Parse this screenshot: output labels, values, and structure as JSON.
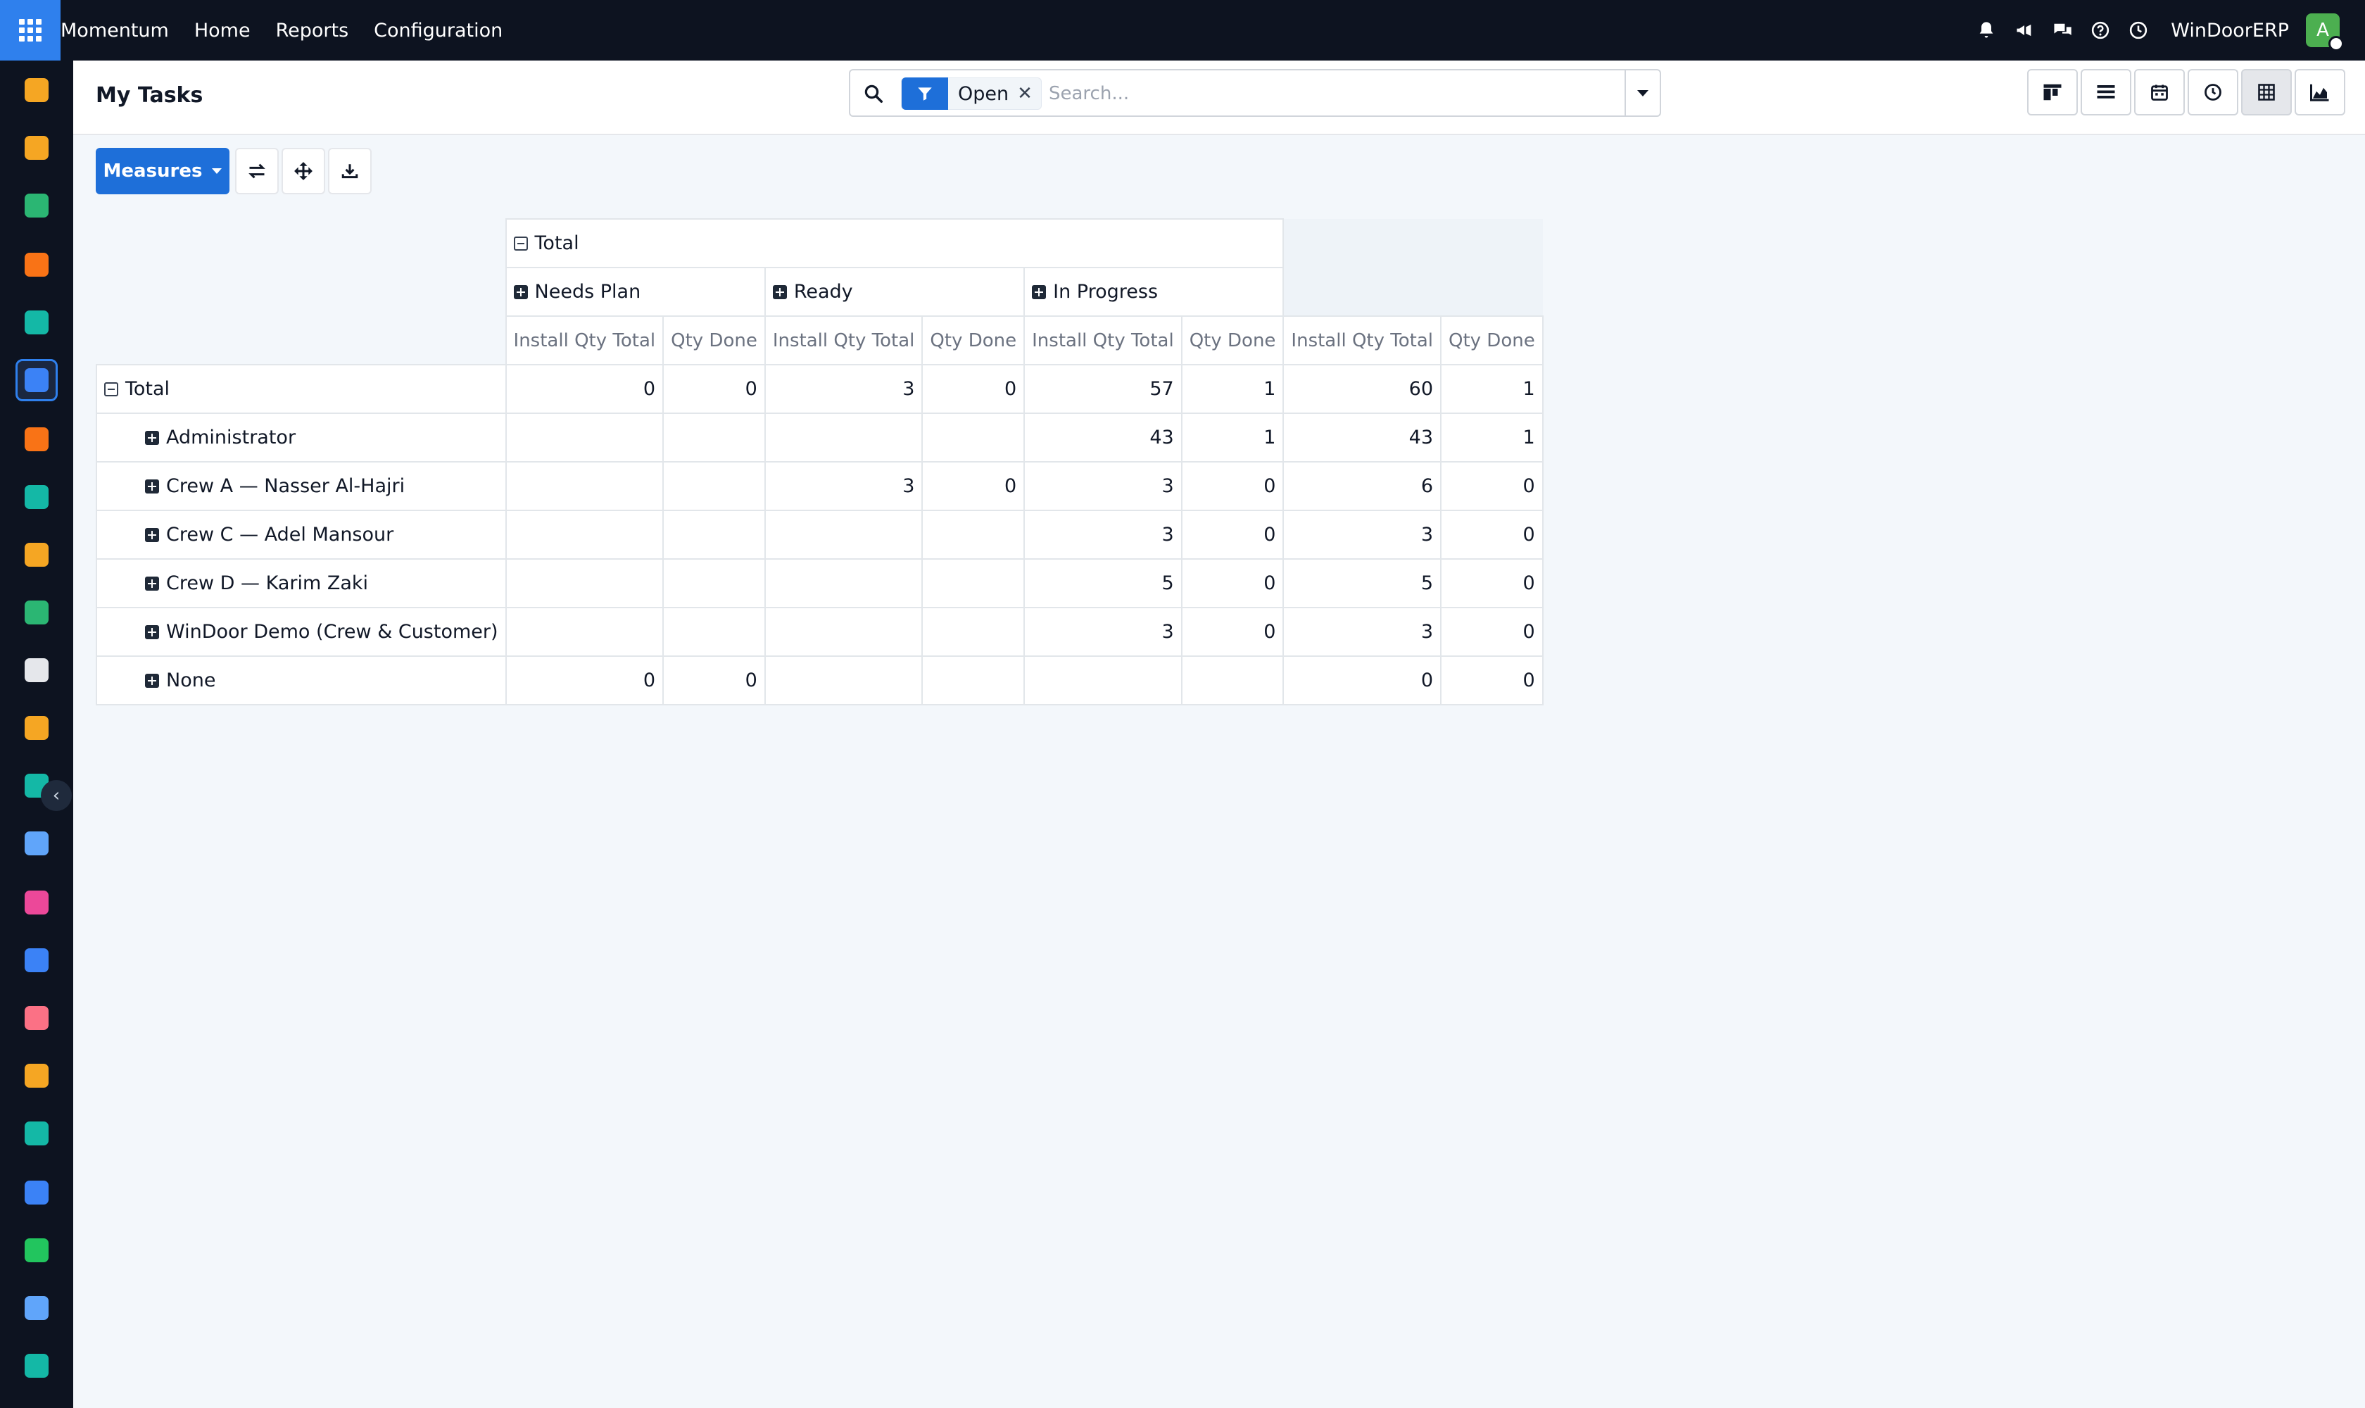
{
  "navbar": {
    "brand": "Momentum",
    "menu": [
      "Home",
      "Reports",
      "Configuration"
    ],
    "company": "WinDoorERP",
    "avatar_initial": "A",
    "icons": [
      "bell-icon",
      "megaphone-icon",
      "chat-icon",
      "help-icon",
      "clock-icon"
    ]
  },
  "sidebar": {
    "apps": [
      {
        "icon": "chart-bars-icon",
        "color": "#f5a623"
      },
      {
        "icon": "chemistry-icon",
        "color": "#f5a623"
      },
      {
        "icon": "contacts-icon",
        "color": "#2bb673"
      },
      {
        "icon": "chat-bubble-icon",
        "color": "#f97316"
      },
      {
        "icon": "wave-icon",
        "color": "#14b8a6"
      },
      {
        "icon": "momentum-icon",
        "color": "#3b82f6"
      },
      {
        "icon": "chat-bubble-icon",
        "color": "#f97316"
      },
      {
        "icon": "check-icon",
        "color": "#14b8a6"
      },
      {
        "icon": "chart-bars-icon",
        "color": "#f5a623"
      },
      {
        "icon": "contacts-icon",
        "color": "#2bb673"
      },
      {
        "icon": "box-icon",
        "color": "#e5e7eb"
      },
      {
        "icon": "chemistry-icon",
        "color": "#f5a623"
      },
      {
        "icon": "check-icon",
        "color": "#14b8a6"
      },
      {
        "icon": "book-icon",
        "color": "#60a5fa"
      },
      {
        "icon": "cube-icon",
        "color": "#ec4899"
      },
      {
        "icon": "dollar-icon",
        "color": "#3b82f6"
      },
      {
        "icon": "team-icon",
        "color": "#fb7185"
      },
      {
        "icon": "calendar-31-icon",
        "color": "#f5a623"
      },
      {
        "icon": "pen-icon",
        "color": "#14b8a6"
      },
      {
        "icon": "dashboard-icon",
        "color": "#3b82f6"
      },
      {
        "icon": "whatsapp-icon",
        "color": "#22c55e"
      },
      {
        "icon": "compass-icon",
        "color": "#60a5fa"
      },
      {
        "icon": "wave-icon",
        "color": "#14b8a6"
      }
    ],
    "active_index": 5
  },
  "control": {
    "title": "My Tasks",
    "search": {
      "facet_label": "Open",
      "placeholder": "Search..."
    },
    "views": [
      "kanban-view",
      "list-view",
      "calendar-view",
      "activity-view",
      "pivot-view",
      "graph-view"
    ],
    "active_view": "pivot-view"
  },
  "toolbar": {
    "measures_label": "Measures",
    "buttons": [
      "flip-axis-icon",
      "expand-all-icon",
      "download-icon"
    ]
  },
  "pivot": {
    "col_total_label": "Total",
    "col_groups": [
      "Needs Plan",
      "Ready",
      "In Progress"
    ],
    "measures": [
      "Install Qty Total",
      "Qty Done"
    ],
    "row_total_label": "Total",
    "total_row": [
      "0",
      "0",
      "3",
      "0",
      "57",
      "1",
      "60",
      "1"
    ],
    "rows": [
      {
        "label": "Administrator",
        "values": [
          "",
          "",
          "",
          "",
          "43",
          "1",
          "43",
          "1"
        ]
      },
      {
        "label": "Crew A — Nasser Al-Hajri",
        "values": [
          "",
          "",
          "3",
          "0",
          "3",
          "0",
          "6",
          "0"
        ]
      },
      {
        "label": "Crew C — Adel Mansour",
        "values": [
          "",
          "",
          "",
          "",
          "3",
          "0",
          "3",
          "0"
        ]
      },
      {
        "label": "Crew D — Karim Zaki",
        "values": [
          "",
          "",
          "",
          "",
          "5",
          "0",
          "5",
          "0"
        ]
      },
      {
        "label": "WinDoor Demo (Crew & Customer)",
        "values": [
          "",
          "",
          "",
          "",
          "3",
          "0",
          "3",
          "0"
        ]
      },
      {
        "label": "None",
        "values": [
          "0",
          "0",
          "",
          "",
          "",
          "",
          "0",
          "0"
        ]
      }
    ]
  }
}
